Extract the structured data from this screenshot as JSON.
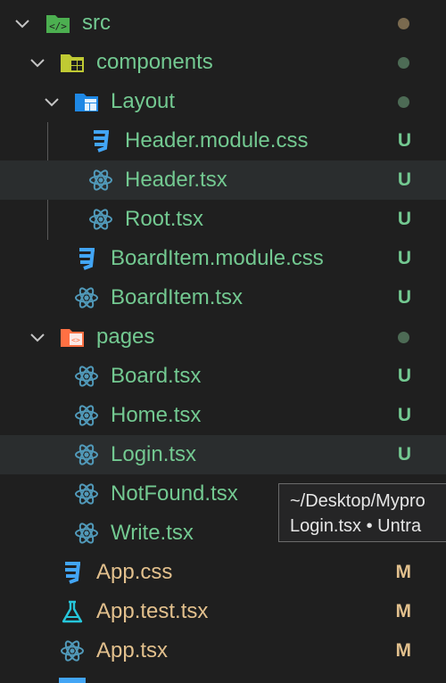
{
  "explorer": {
    "items": [
      {
        "label": "src",
        "icon": "folder-src-icon",
        "status": "dot",
        "expanded": true
      },
      {
        "label": "components",
        "icon": "folder-components-icon",
        "status": "dot",
        "expanded": true
      },
      {
        "label": "Layout",
        "icon": "folder-layout-icon",
        "status": "dot",
        "expanded": true
      },
      {
        "label": "Header.module.css",
        "icon": "css-icon",
        "status": "U"
      },
      {
        "label": "Header.tsx",
        "icon": "react-icon",
        "status": "U"
      },
      {
        "label": "Root.tsx",
        "icon": "react-icon",
        "status": "U"
      },
      {
        "label": "BoardItem.module.css",
        "icon": "css-icon",
        "status": "U"
      },
      {
        "label": "BoardItem.tsx",
        "icon": "react-icon",
        "status": "U"
      },
      {
        "label": "pages",
        "icon": "folder-pages-icon",
        "status": "dot",
        "expanded": true
      },
      {
        "label": "Board.tsx",
        "icon": "react-icon",
        "status": "U"
      },
      {
        "label": "Home.tsx",
        "icon": "react-icon",
        "status": "U"
      },
      {
        "label": "Login.tsx",
        "icon": "react-icon",
        "status": "U"
      },
      {
        "label": "NotFound.tsx",
        "icon": "react-icon",
        "status": ""
      },
      {
        "label": "Write.tsx",
        "icon": "react-icon",
        "status": ""
      },
      {
        "label": "App.css",
        "icon": "css-icon",
        "status": "M"
      },
      {
        "label": "App.test.tsx",
        "icon": "test-flask-icon",
        "status": "M"
      },
      {
        "label": "App.tsx",
        "icon": "react-icon",
        "status": "M"
      }
    ]
  },
  "tooltip": {
    "path": "~/Desktop/Mypro",
    "detail": "Login.tsx • Untra"
  },
  "colors": {
    "untracked": "#73c991",
    "modified": "#e2c08d",
    "react": "#519aba",
    "css": "#42a5f5",
    "folder_src": "#4caf50",
    "folder_components": "#c0ca33",
    "folder_layout": "#1e88e5",
    "folder_pages": "#ff7043",
    "dot_green": "#4d6b55",
    "dot_brown": "#7a6a4f"
  }
}
